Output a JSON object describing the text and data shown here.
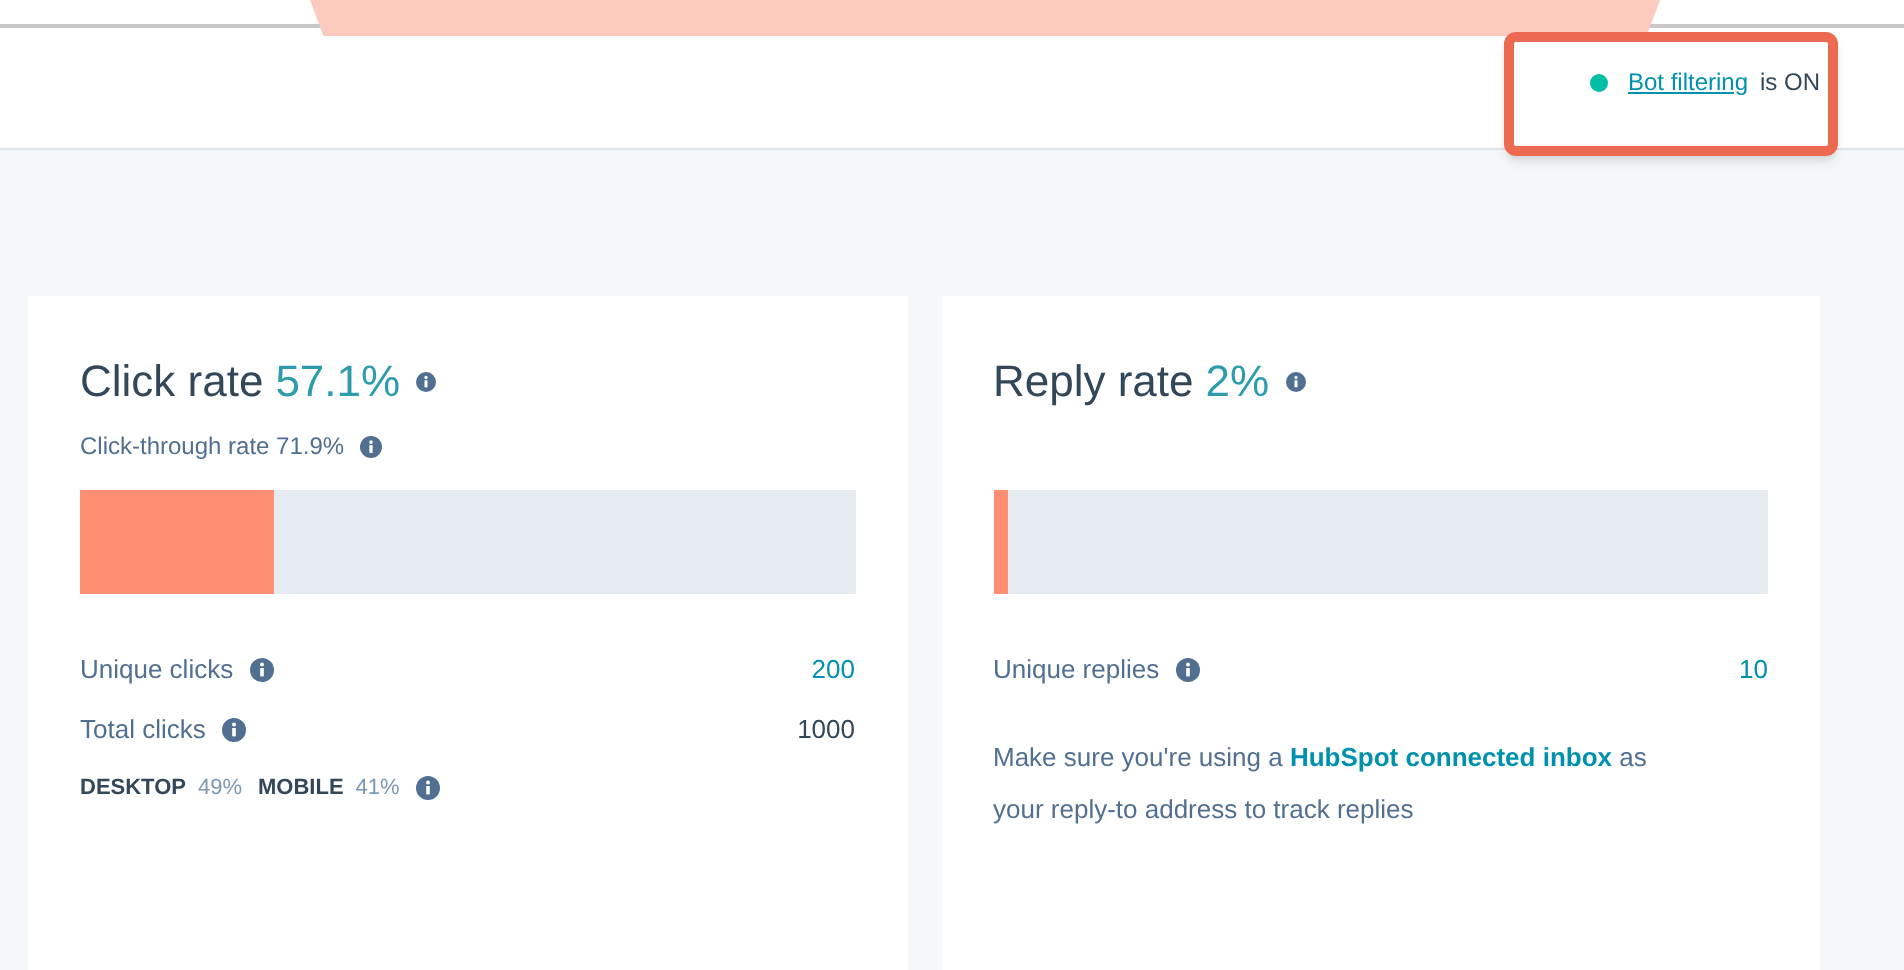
{
  "header": {
    "status_on": true,
    "status_link": "Bot filtering",
    "status_text": "is ON"
  },
  "cards": [
    {
      "title": "Click rate",
      "value": "57.1%",
      "subtitle": "Click-through rate 71.9%",
      "level": 0.25,
      "stats": [
        {
          "label": "Unique clicks",
          "value": "200",
          "kind": "link"
        },
        {
          "label": "Total clicks",
          "value": "1000",
          "kind": "plain"
        }
      ],
      "devices": [
        {
          "label": "DESKTOP",
          "value": "49%"
        },
        {
          "label": "MOBILE",
          "value": "41%"
        }
      ]
    },
    {
      "title": "Reply rate",
      "value": "2%",
      "level": 0.02,
      "stats": [
        {
          "label": "Unique replies",
          "value": "10",
          "kind": "link"
        }
      ],
      "note": {
        "before": "Make sure you're using a",
        "link": "HubSpot connected inbox",
        "after": "as your reply-to address to track replies"
      }
    }
  ]
}
